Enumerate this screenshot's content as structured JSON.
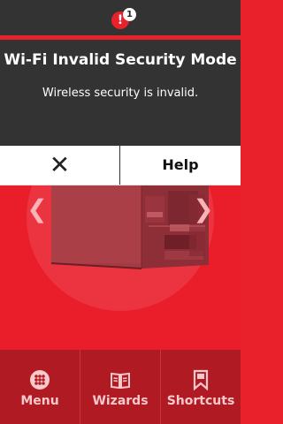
{
  "status": {
    "alert_glyph": "!",
    "alert_count": "1",
    "accent_color": "#e8212b"
  },
  "dialog": {
    "title": "Wi-Fi Invalid Security Mode",
    "message": "Wireless security is invalid."
  },
  "actions": {
    "close_glyph": "✕",
    "help_label": "Help"
  },
  "carousel": {
    "prev_glyph": "❮",
    "next_glyph": "❯",
    "image": "printer-image"
  },
  "bottom_nav": {
    "menu_label": "Menu",
    "wizards_label": "Wizards",
    "shortcuts_label": "Shortcuts"
  }
}
